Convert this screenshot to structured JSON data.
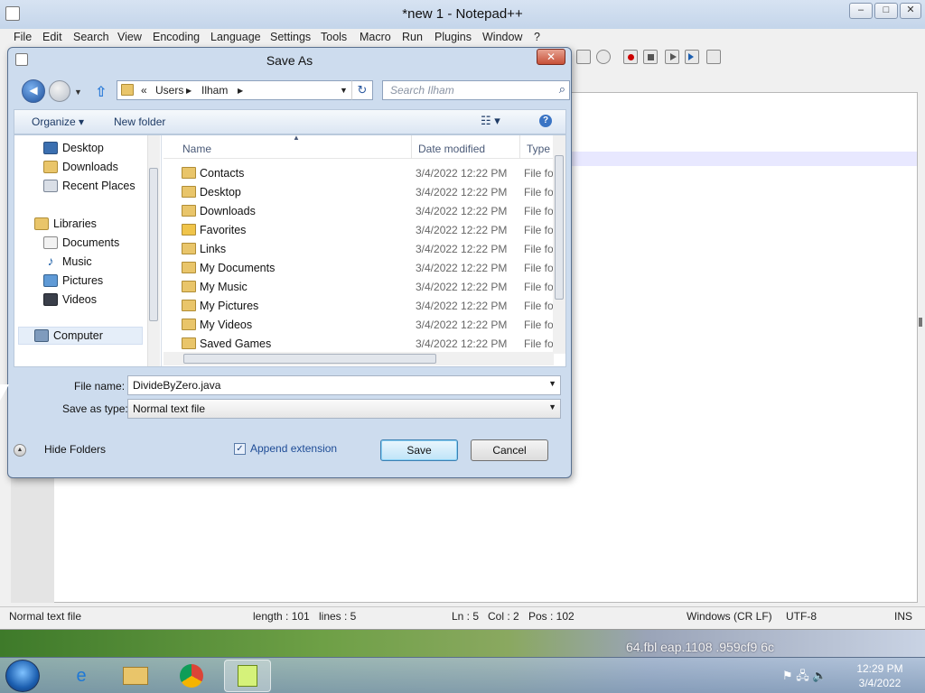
{
  "npp": {
    "title": "*new 1 - Notepad++",
    "menu": [
      "File",
      "Edit",
      "Search",
      "View",
      "Encoding",
      "Language",
      "Settings",
      "Tools",
      "Macro",
      "Run",
      "Plugins",
      "Window",
      "?"
    ],
    "status": {
      "type": "Normal text file",
      "length": "length : 101",
      "lines": "lines : 5",
      "ln": "Ln : 5",
      "col": "Col : 2",
      "pos": "Pos : 102",
      "eol": "Windows (CR LF)",
      "encoding": "UTF-8",
      "mode": "INS"
    }
  },
  "dialog": {
    "title": "Save As",
    "close": "✕",
    "address": {
      "root": "«",
      "items": [
        "Users",
        "Ilham"
      ]
    },
    "search_placeholder": "Search Ilham",
    "organize": "Organize ▾",
    "new_folder": "New folder",
    "nav": {
      "favorites": [
        {
          "label": "Desktop",
          "icon": "desktop-icon"
        },
        {
          "label": "Downloads",
          "icon": "downloads-icon"
        },
        {
          "label": "Recent Places",
          "icon": "recent-places-icon"
        }
      ],
      "libraries_label": "Libraries",
      "libraries": [
        {
          "label": "Documents",
          "icon": "documents-icon"
        },
        {
          "label": "Music",
          "icon": "music-icon"
        },
        {
          "label": "Pictures",
          "icon": "pictures-icon"
        },
        {
          "label": "Videos",
          "icon": "videos-icon"
        }
      ],
      "computer": "Computer"
    },
    "columns": {
      "name": "Name",
      "date": "Date modified",
      "type": "Type"
    },
    "files": [
      {
        "name": "Contacts",
        "date": "3/4/2022 12:22 PM",
        "type": "File folder"
      },
      {
        "name": "Desktop",
        "date": "3/4/2022 12:22 PM",
        "type": "File folder"
      },
      {
        "name": "Downloads",
        "date": "3/4/2022 12:22 PM",
        "type": "File folder"
      },
      {
        "name": "Favorites",
        "date": "3/4/2022 12:22 PM",
        "type": "File folder"
      },
      {
        "name": "Links",
        "date": "3/4/2022 12:22 PM",
        "type": "File folder"
      },
      {
        "name": "My Documents",
        "date": "3/4/2022 12:22 PM",
        "type": "File folder"
      },
      {
        "name": "My Music",
        "date": "3/4/2022 12:22 PM",
        "type": "File folder"
      },
      {
        "name": "My Pictures",
        "date": "3/4/2022 12:22 PM",
        "type": "File folder"
      },
      {
        "name": "My Videos",
        "date": "3/4/2022 12:22 PM",
        "type": "File folder"
      },
      {
        "name": "Saved Games",
        "date": "3/4/2022 12:22 PM",
        "type": "File folder"
      }
    ],
    "file_name_label": "File name:",
    "file_name_value": "DivideByZero.java",
    "save_type_label": "Save as type:",
    "save_type_value": "Normal text file",
    "hide_folders": "Hide Folders",
    "append_extension": "Append extension",
    "append_checked": true,
    "save": "Save",
    "cancel": "Cancel"
  },
  "taskbar": {
    "time": "12:29 PM",
    "date": "3/4/2022",
    "apps": [
      "internet-explorer-icon",
      "file-explorer-icon",
      "chrome-icon",
      "notepad-plus-plus-icon"
    ]
  },
  "wallpaper_text": "64.fbl  eap.1108  .959cf9  6c"
}
